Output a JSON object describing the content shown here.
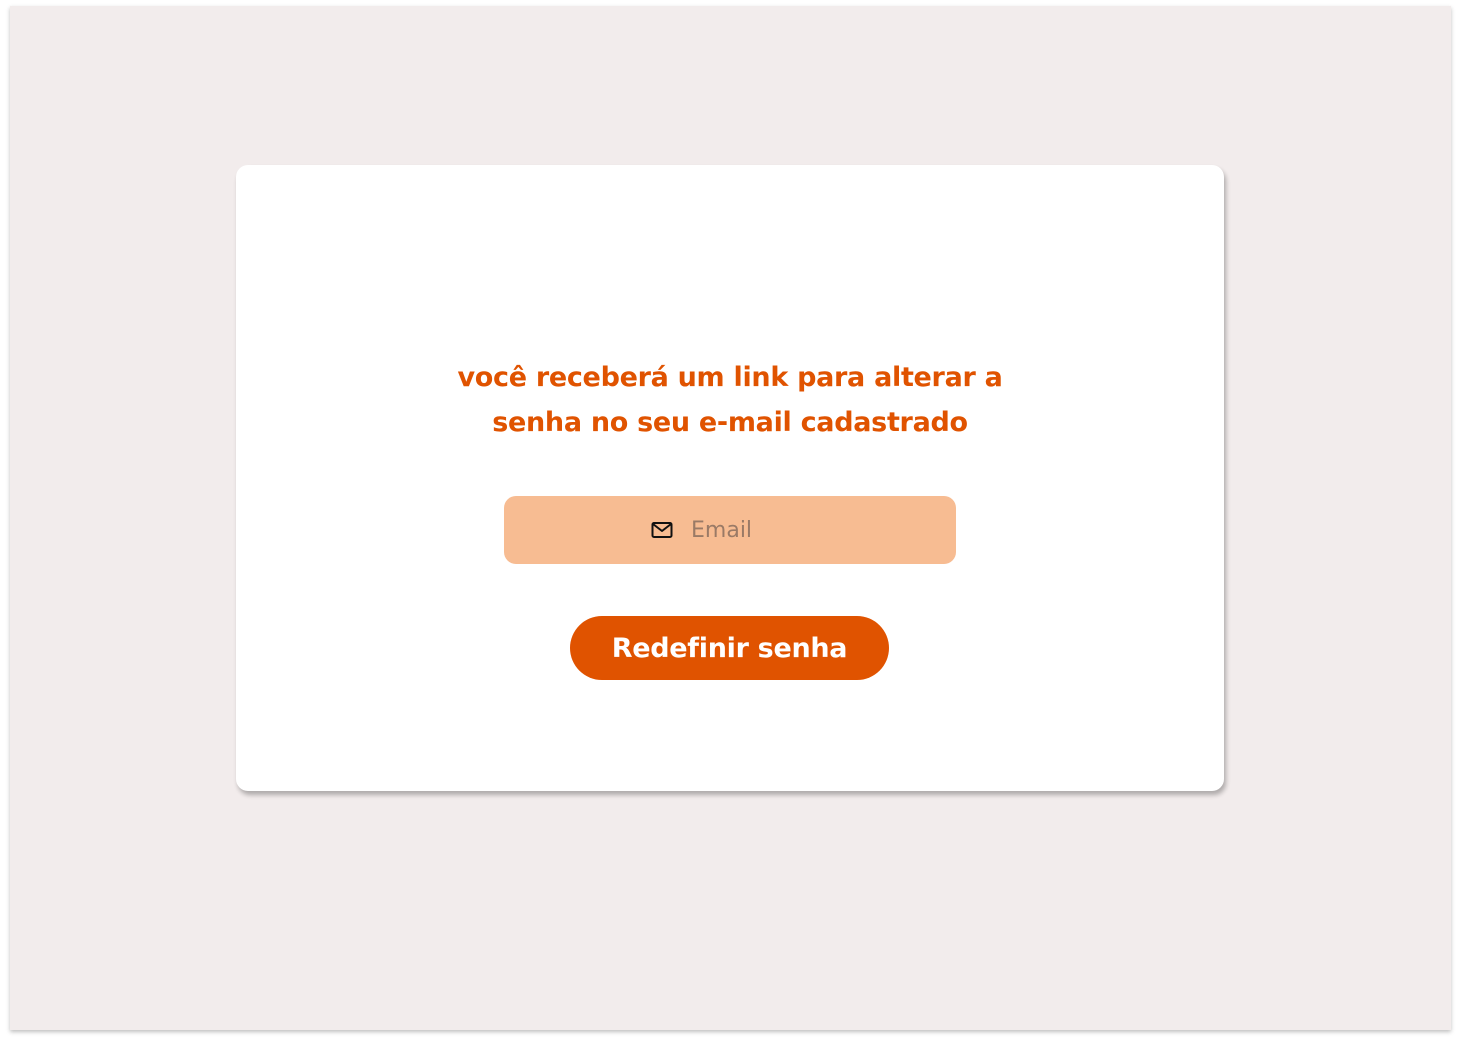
{
  "reset_form": {
    "message_line1": "você receberá um link para alterar a",
    "message_line2": "senha no seu e-mail cadastrado",
    "email_placeholder": "Email",
    "email_icon": "mail-icon",
    "submit_label": "Redefinir senha"
  },
  "colors": {
    "accent": "#e05300",
    "field_background": "#f7bc92",
    "page_background": "#f2ecec",
    "card_background": "#ffffff"
  }
}
